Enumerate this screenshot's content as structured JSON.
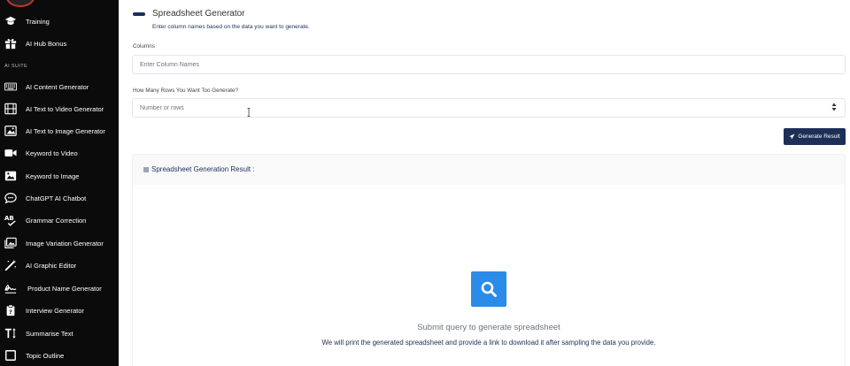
{
  "sidebar": {
    "section_label": "AI SUITE",
    "items": [
      {
        "label": "Training",
        "icon": "graduation-cap-icon"
      },
      {
        "label": "AI Hub Bonus",
        "icon": "gift-icon"
      },
      {
        "label": "AI Content Generator",
        "icon": "keyboard-icon"
      },
      {
        "label": "AI Text to Video Generator",
        "icon": "film-icon"
      },
      {
        "label": "AI Text to Image Generator",
        "icon": "image-icon"
      },
      {
        "label": "Keyword to Video",
        "icon": "video-camera-icon"
      },
      {
        "label": "Keyword to Image",
        "icon": "picture-icon"
      },
      {
        "label": "ChatGPT AI Chatbot",
        "icon": "chat-bubble-icon"
      },
      {
        "label": "Grammar Correction",
        "icon": "spell-check-icon"
      },
      {
        "label": "Image Variation Generator",
        "icon": "images-icon"
      },
      {
        "label": "AI Graphic Editor",
        "icon": "magic-wand-icon"
      },
      {
        "label": "Product Name Generator",
        "icon": "signature-icon"
      },
      {
        "label": "Interview Generator",
        "icon": "clipboard-icon"
      },
      {
        "label": "Summarise Text",
        "icon": "text-height-icon"
      },
      {
        "label": "Topic Outline",
        "icon": "square-outline-icon"
      }
    ]
  },
  "page": {
    "title": "Spreadsheet Generator",
    "subtitle": "Enter column names based on the data you want to generate.",
    "columns_label": "Columns",
    "columns_placeholder": "Enter Column Names",
    "rows_label": "How Many Rows You Want Too Generate?",
    "rows_placeholder": "Number or rows",
    "generate_button": "Generate Result"
  },
  "result": {
    "heading": "Spreadsheet Generation Result :",
    "empty_title": "Submit query to generate spreadsheet",
    "empty_description": "We will print the generated spreadsheet and provide a link to download it after sampling the data you provide."
  },
  "colors": {
    "sidebar_bg": "#0b0b0b",
    "brand_navy": "#1d2f57",
    "search_blue": "#2b8be9"
  }
}
